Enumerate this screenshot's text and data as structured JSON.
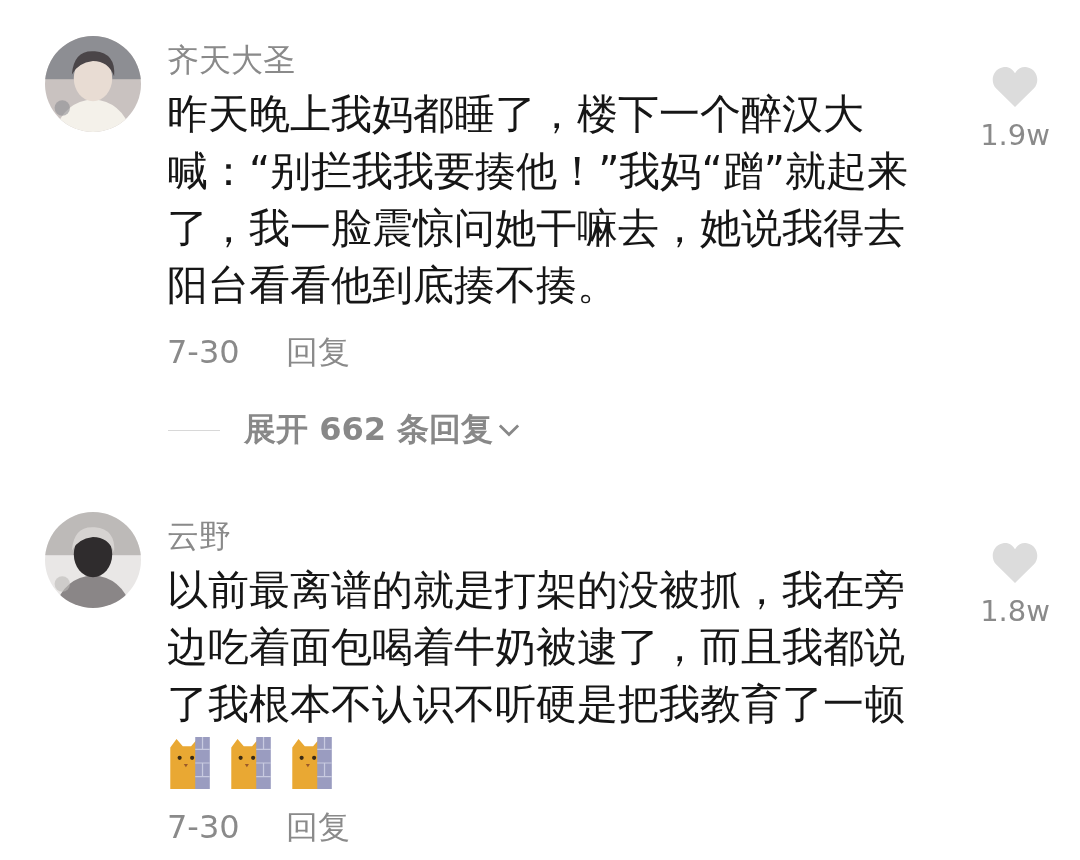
{
  "comments": [
    {
      "author": "齐天大圣",
      "text": "昨天晚上我妈都睡了，楼下一个醉汉大喊：“别拦我我要揍他！”我妈“蹭”就起来了，我一脸震惊问她干嘛去，她说我得去阳台看看他到底揍不揍。",
      "date": "7-30",
      "reply": "回复",
      "likes": "1.9w",
      "liked": false,
      "expand_replies": "展开 662 条回复"
    },
    {
      "author": "云野",
      "text": "以前最离谱的就是打架的没被抓，我在旁边吃着面包喝着牛奶被逮了，而且我都说了我根本不认识不听硬是把我教育了一顿",
      "emojis": [
        {
          "kind": "cat-peeking"
        },
        {
          "kind": "cat-peeking"
        },
        {
          "kind": "cat-peeking"
        }
      ],
      "date": "7-30",
      "reply": "回复",
      "likes": "1.8w",
      "liked": false
    }
  ]
}
